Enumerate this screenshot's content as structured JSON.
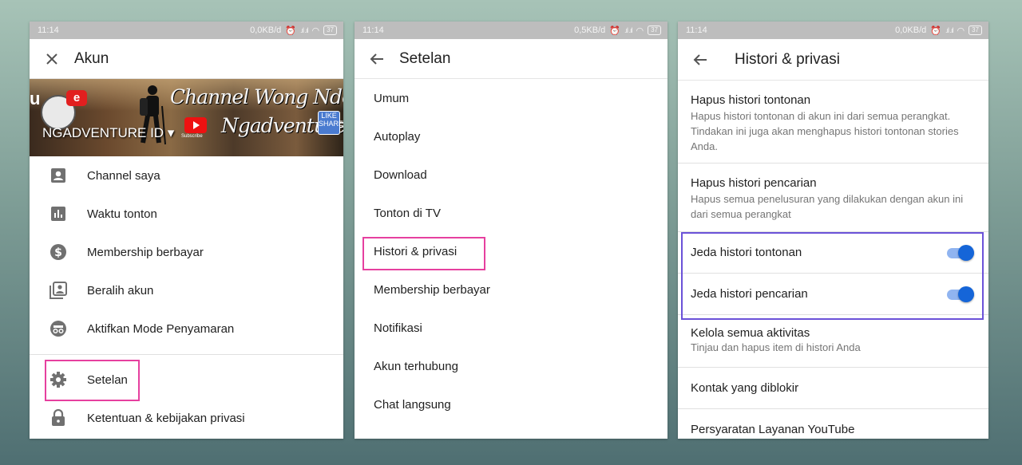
{
  "status": {
    "time": "11:14",
    "battery": "37",
    "speeds": [
      "0,0KB/d",
      "0,5KB/d",
      "0,0KB/d"
    ]
  },
  "account_screen": {
    "title": "Akun",
    "banner": {
      "channel_text": "Channel Wong Ndeso Senen",
      "ngadventure": "Ngadventure",
      "account_name_prefix": "VENTURE ID",
      "account_name": "NGADVENTURE ID",
      "logo_letters": "u e",
      "like_badge": "LIKE & SHARE",
      "subscribe": "Subscribe"
    },
    "items": [
      {
        "label": "Channel saya",
        "icon": "account-box-icon"
      },
      {
        "label": "Waktu tonton",
        "icon": "bar-chart-icon"
      },
      {
        "label": "Membership berbayar",
        "icon": "dollar-circle-icon"
      },
      {
        "label": "Beralih akun",
        "icon": "switch-account-icon"
      },
      {
        "label": "Aktifkan Mode Penyamaran",
        "icon": "incognito-icon"
      }
    ],
    "items2": [
      {
        "label": "Setelan",
        "icon": "gear-icon"
      },
      {
        "label": "Ketentuan & kebijakan privasi",
        "icon": "lock-icon"
      }
    ]
  },
  "settings_screen": {
    "title": "Setelan",
    "items": [
      "Umum",
      "Autoplay",
      "Download",
      "Tonton di TV",
      "Histori & privasi",
      "Membership berbayar",
      "Notifikasi",
      "Akun terhubung",
      "Chat langsung"
    ]
  },
  "privacy_screen": {
    "title": "Histori & privasi",
    "clear_watch": {
      "title": "Hapus histori tontonan",
      "subtitle": "Hapus histori tontonan di akun ini dari semua perangkat. Tindakan ini juga akan menghapus histori tontonan stories Anda."
    },
    "clear_search": {
      "title": "Hapus histori pencarian",
      "subtitle": "Hapus semua penelusuran yang dilakukan dengan akun ini dari semua perangkat"
    },
    "pause_watch": {
      "label": "Jeda histori tontonan",
      "on": true
    },
    "pause_search": {
      "label": "Jeda histori pencarian",
      "on": true
    },
    "manage": {
      "title": "Kelola semua aktivitas",
      "subtitle": "Tinjau dan hapus item di histori Anda"
    },
    "blocked": {
      "title": "Kontak yang diblokir"
    },
    "tos": {
      "title": "Persyaratan Layanan YouTube"
    }
  },
  "colors": {
    "highlight_pink": "#e6409f",
    "highlight_purple": "#6b52d8",
    "toggle_blue": "#1565d8"
  }
}
